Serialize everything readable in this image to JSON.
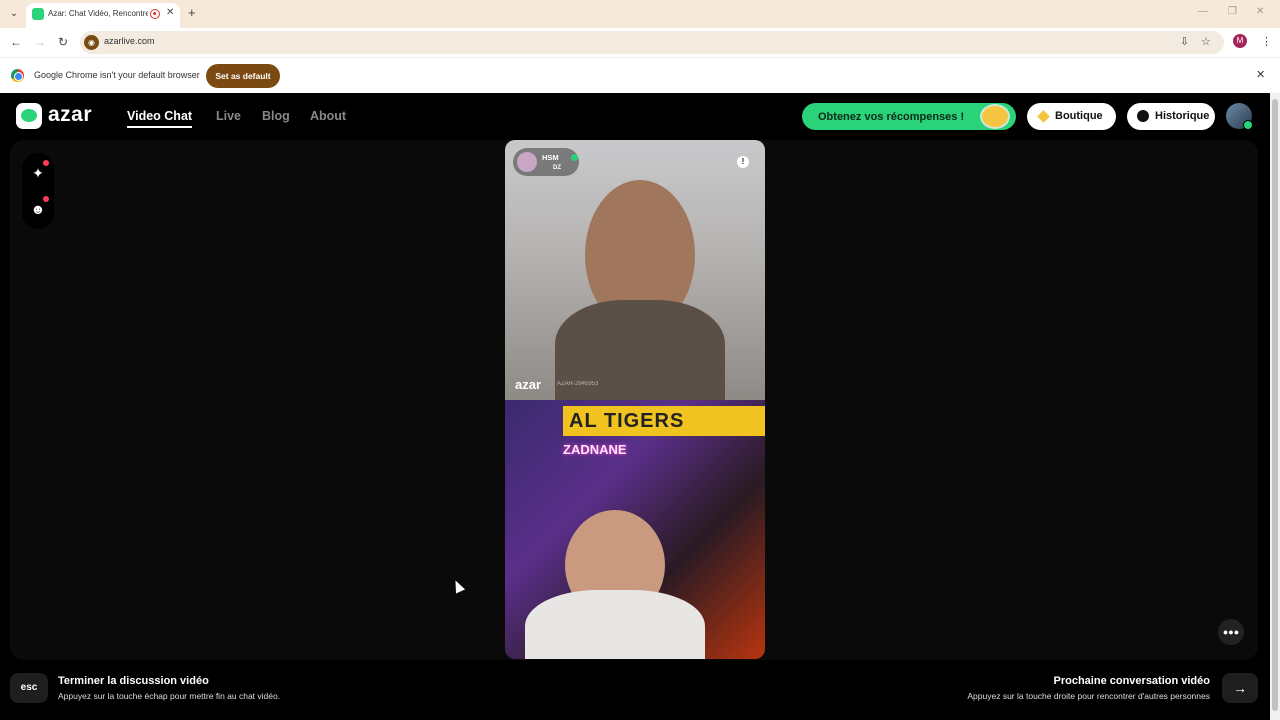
{
  "browser": {
    "tab_title": "Azar: Chat Vidéo, Rencontre",
    "url": "azarlive.com",
    "profile_initial": "M",
    "infobar_text": "Google Chrome isn't your default browser",
    "set_default_label": "Set as default"
  },
  "header": {
    "logo_text": "azar",
    "nav": [
      "Video Chat",
      "Live",
      "Blog",
      "About"
    ],
    "rewards_label": "Obtenez vos récompenses !",
    "boutique_label": "Boutique",
    "historique_label": "Historique"
  },
  "video": {
    "peer_name": "HSM",
    "peer_country": "DZ",
    "watermark": "azar",
    "watermark_id": "AZAR-2845953",
    "banner_text": "AL TIGERS",
    "neon_text": "ZADNANE"
  },
  "footer": {
    "esc_key": "esc",
    "end_title": "Terminer la discussion vidéo",
    "end_hint": "Appuyez sur la touche échap pour mettre fin au chat vidéo.",
    "next_title": "Prochaine conversation vidéo",
    "next_hint": "Appuyez sur la touche droite pour rencontrer d'autres personnes",
    "next_key": "→"
  },
  "colors": {
    "accent": "#2ad27a",
    "browser_accent": "#7a4a12",
    "notification_dot": "#ff3b5c"
  }
}
